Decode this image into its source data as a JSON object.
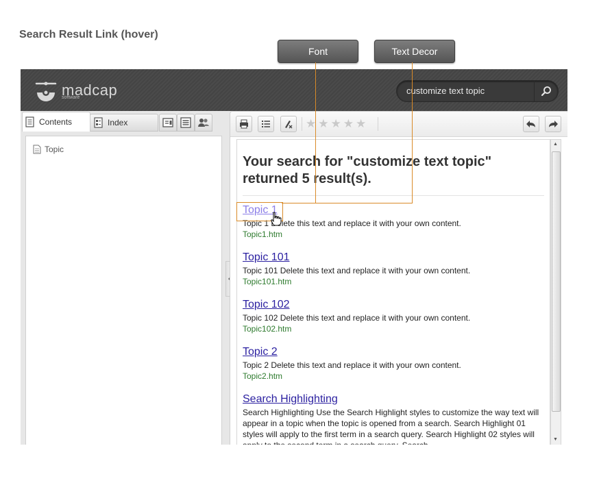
{
  "caption": "Search Result Link (hover)",
  "callouts": {
    "font": "Font",
    "text_decor": "Text Decor"
  },
  "header": {
    "logo_text": "madcap",
    "logo_sub": "software",
    "search_value": "customize text topic"
  },
  "nav": {
    "tabs": {
      "contents": "Contents",
      "index": "Index"
    },
    "tree": [
      {
        "label": "Topic"
      }
    ]
  },
  "toolbar": {
    "rating_stars": 5
  },
  "results": {
    "heading": "Your search for \"customize text topic\" returned 5 result(s).",
    "items": [
      {
        "title": "Topic 1",
        "desc": "Topic 1 Delete this text and replace it with your own content.",
        "url": "Topic1.htm"
      },
      {
        "title": "Topic 101",
        "desc": "Topic 101 Delete this text and replace it with your own content.",
        "url": "Topic101.htm"
      },
      {
        "title": "Topic 102",
        "desc": "Topic 102 Delete this text and replace it with your own content.",
        "url": "Topic102.htm"
      },
      {
        "title": "Topic 2",
        "desc": "Topic 2 Delete this text and replace it with your own content.",
        "url": "Topic2.htm"
      },
      {
        "title": "Search Highlighting",
        "desc": "Search Highlighting Use the Search Highlight styles to customize the way text will appear in a topic when the topic is opened from a search. Search Highlight 01 styles will apply to the first term in a search query. Search Highlight 02 styles will apply to the second term in a search query. Search",
        "url": ""
      }
    ]
  },
  "colors": {
    "callout_line": "#d98a27",
    "link": "#2a1fa0",
    "link_hover": "#8b7ee8",
    "url": "#2d7a2d",
    "header_bg": "#484848"
  }
}
